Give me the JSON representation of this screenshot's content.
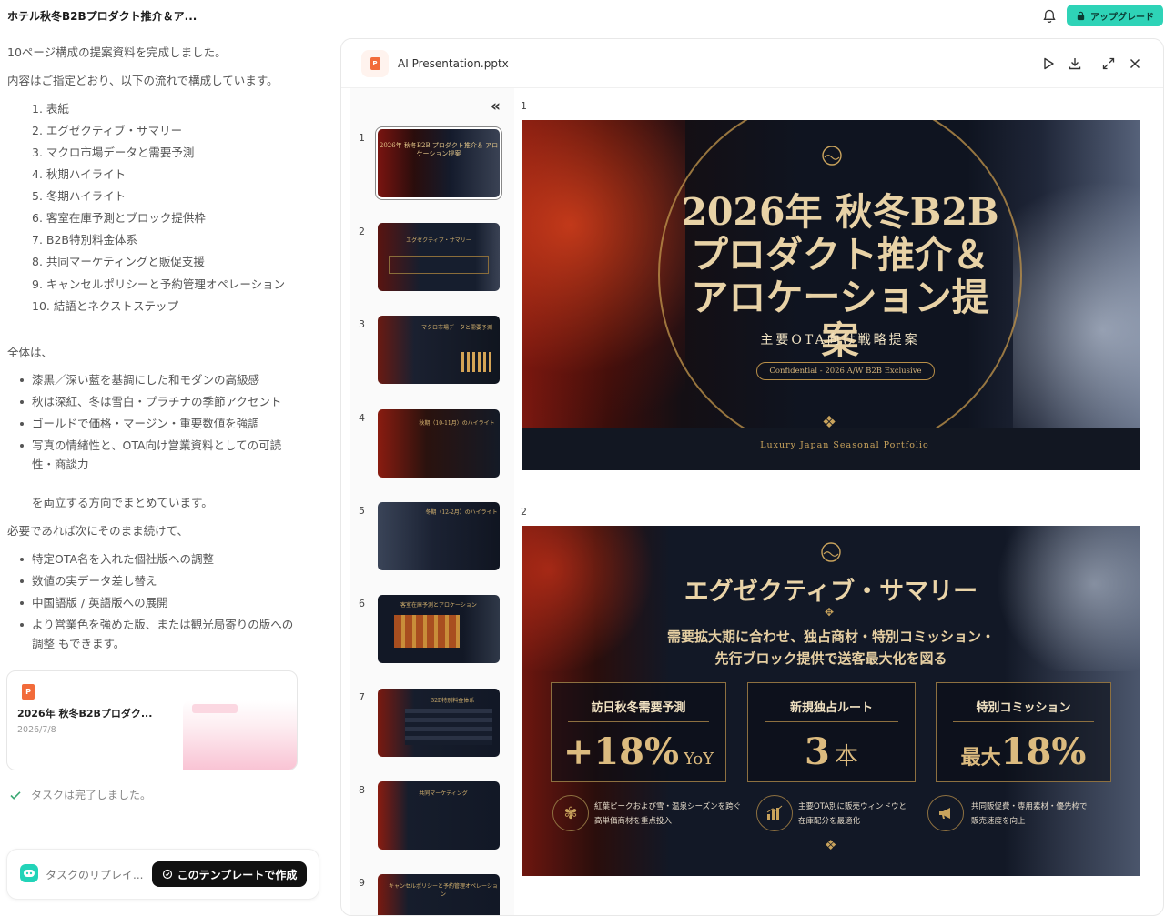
{
  "header": {
    "title": "ホテル秋冬B2Bプロダクト推介＆ア...",
    "upgrade_label": "アップグレード"
  },
  "chat": {
    "intro1": "10ページ構成の提案資料を完成しました。",
    "intro2": "内容はご指定どおり、以下の流れで構成しています。",
    "steps": [
      "1. 表紙",
      "2. エグゼクティブ・サマリー",
      "3. マクロ市場データと需要予測",
      "4. 秋期ハイライト",
      "5. 冬期ハイライト",
      "6. 客室在庫予測とブロック提供枠",
      "7. B2B特別料金体系",
      "8. 共同マーケティングと販促支援",
      "9. キャンセルポリシーと予約管理オペレーション",
      "10. 結語とネクストステップ"
    ],
    "overall": "全体は、",
    "design_points": [
      "漆黒／深い藍を基調にした和モダンの高級感",
      "秋は深紅、冬は雪白・プラチナの季節アクセント",
      "ゴールドで価格・マージン・重要数値を強調",
      "写真の情緒性と、OTA向け営業資料としての可読性・商談力"
    ],
    "balance": "を両立する方向でまとめています。",
    "next": "必要であれば次にそのまま続けて、",
    "options": [
      "特定OTA名を入れた個社版への調整",
      "数値の実データ差し替え",
      "中国語版 / 英語版への展開",
      "より営業色を強めた版、または観光局寄りの版への調整 もできます。"
    ],
    "file": {
      "name": "2026年 秋冬B2Bプロダク...",
      "date": "2026/7/8",
      "icon_letter": "P"
    },
    "done": "タスクは完了しました。",
    "replay_label": "タスクのリプレイ...",
    "template_button": "このテンプレートで作成"
  },
  "viewer": {
    "filename": "AI Presentation.pptx",
    "thumbnails": [
      {
        "num": "1",
        "title": "2026年 秋冬B2B プロダクト推介＆ アロケーション提案"
      },
      {
        "num": "2",
        "title": "エグゼクティブ・サマリー"
      },
      {
        "num": "3",
        "title": "マクロ市場データと需要予測"
      },
      {
        "num": "4",
        "title": "秋期（10-11月）のハイライト"
      },
      {
        "num": "5",
        "title": "冬期（12-2月）のハイライト"
      },
      {
        "num": "6",
        "title": "客室在庫予測とアロケーション"
      },
      {
        "num": "7",
        "title": "B2B特別料金体系"
      },
      {
        "num": "8",
        "title": "共同マーケティング"
      },
      {
        "num": "9",
        "title": "キャンセルポリシーと予約管理オペレーション"
      }
    ],
    "slide1": {
      "num": "1",
      "title_l1": "2026年 秋冬B2B",
      "title_l2": "プロダクト推介＆",
      "title_l3": "アロケーション提案",
      "subtitle": "主要OTA向け戦略提案",
      "badge": "Confidential - 2026 A/W B2B Exclusive",
      "footer": "Luxury Japan Seasonal Portfolio"
    },
    "slide2": {
      "num": "2",
      "title": "エグゼクティブ・サマリー",
      "lead1": "需要拡大期に合わせ、独占商材・特別コミッション・",
      "lead2": "先行ブロック提供で送客最大化を図る",
      "kpis": [
        {
          "label": "訪日秋冬需要予測",
          "value": "+18%",
          "unit": "YoY"
        },
        {
          "label": "新規独占ルート",
          "value": "3",
          "unit": "本"
        },
        {
          "label": "特別コミッション",
          "prefix": "最大",
          "value": "18%",
          "unit": ""
        }
      ],
      "points": [
        {
          "icon": "maple-leaf-icon",
          "l1": "紅葉ピークおよび雪・温泉シーズンを跨ぐ",
          "l2": "高単価商材を重点投入"
        },
        {
          "icon": "bar-chart-icon",
          "l1": "主要OTA別に販売ウィンドウと",
          "l2": "在庫配分を最適化"
        },
        {
          "icon": "megaphone-icon",
          "l1": "共同販促費・専用素材・優先枠で",
          "l2": "販売速度を向上"
        }
      ]
    }
  }
}
